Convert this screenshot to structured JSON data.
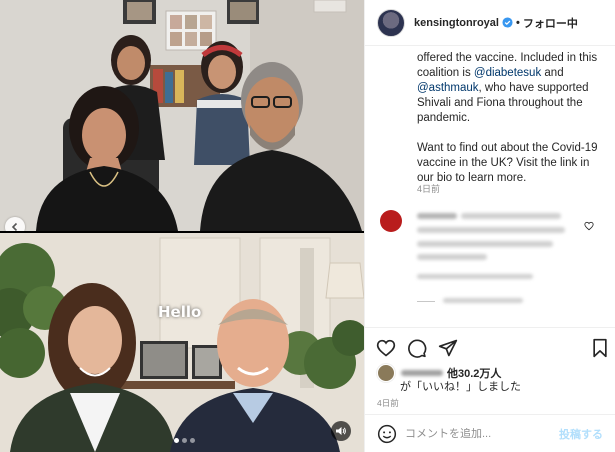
{
  "header": {
    "account": "kensingtonroyal",
    "separator": "•",
    "follow_label": "フォロー中"
  },
  "caption": {
    "line1": "offered the vaccine. Included in this coalition is ",
    "mention1": "@diabetesuk",
    "line2": " and ",
    "mention2": "@asthmauk",
    "line3": ", who have supported Shivali and Fiona throughout the pandemic.",
    "para2": "Want to find out about the Covid-19 vaccine in the UK? Visit the link in our bio to learn more.",
    "time": "4日前"
  },
  "media": {
    "overlay_text": "Hello",
    "dot_count": 3,
    "active_dot": 0
  },
  "likes": {
    "others": "他30.2万人",
    "suffix": "が「いいね！」しました",
    "time": "4日前"
  },
  "comment_box": {
    "placeholder": "コメントを追加...",
    "post_label": "投稿する"
  },
  "colors": {
    "verified": "#3897f0",
    "link": "#00376b",
    "post_disabled": "#b2dffc"
  }
}
